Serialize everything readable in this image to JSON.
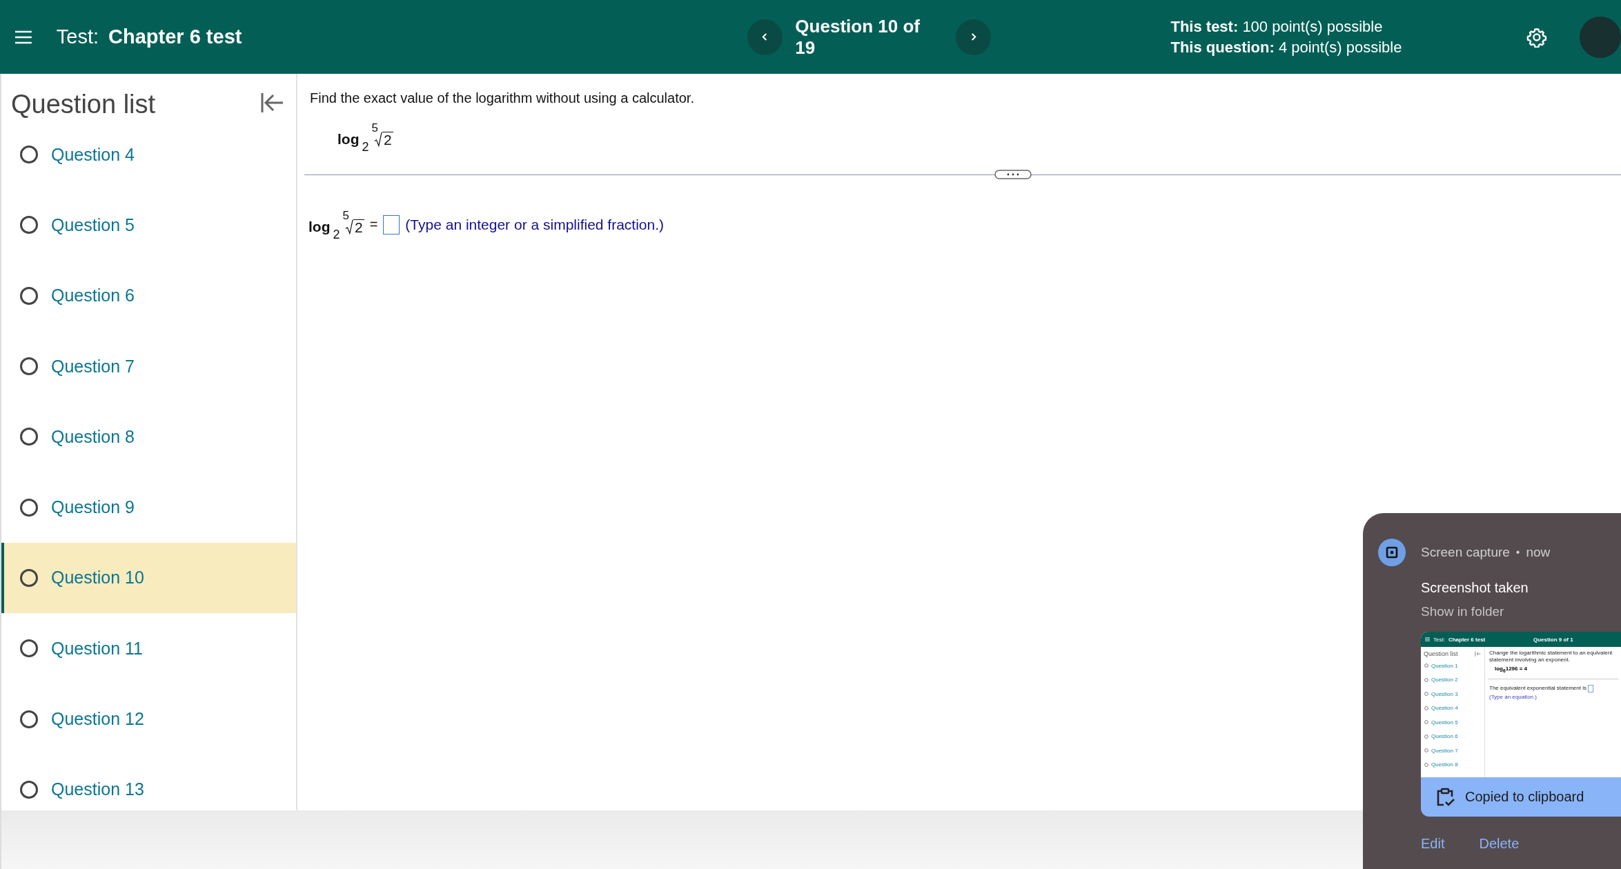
{
  "header": {
    "test_label": "Test:",
    "test_name": "Chapter 6 test",
    "question_position": "Question 10 of 19",
    "points": [
      {
        "label": "This test:",
        "value": "100 point(s) possible"
      },
      {
        "label": "This question:",
        "value": "4 point(s) possible"
      }
    ]
  },
  "sidebar": {
    "title": "Question list",
    "items": [
      {
        "label": "Question 4",
        "selected": false
      },
      {
        "label": "Question 5",
        "selected": false
      },
      {
        "label": "Question 6",
        "selected": false
      },
      {
        "label": "Question 7",
        "selected": false
      },
      {
        "label": "Question 8",
        "selected": false
      },
      {
        "label": "Question 9",
        "selected": false
      },
      {
        "label": "Question 10",
        "selected": true
      },
      {
        "label": "Question 11",
        "selected": false
      },
      {
        "label": "Question 12",
        "selected": false
      },
      {
        "label": "Question 13",
        "selected": false
      }
    ]
  },
  "question": {
    "prompt": "Find the exact value of the logarithm without using a calculator.",
    "expression": {
      "fn": "log",
      "base": "2",
      "index": "5",
      "radicand": "2"
    },
    "answer": {
      "expression": {
        "fn": "log",
        "base": "2",
        "index": "5",
        "radicand": "2"
      },
      "equals": "=",
      "hint": "(Type an integer or a simplified fraction.)"
    }
  },
  "notification": {
    "source": "Screen capture",
    "separator": "•",
    "time": "now",
    "title": "Screenshot taken",
    "link": "Show in folder",
    "thumbnail": {
      "test_label": "Test:",
      "test_name": "Chapter 6 test",
      "question_position": "Question 9 of 1",
      "sidebar_title": "Question list",
      "items": [
        "Question 1",
        "Question 2",
        "Question 3",
        "Question 4",
        "Question 5",
        "Question 6",
        "Question 7",
        "Question 8"
      ],
      "prompt": "Change the logarithmic statement to an equivalent statement involving an exponent.",
      "equation": "log$_{6}$1296 = 4",
      "answer_label": "The equivalent exponential statement is",
      "hint": "(Type an equation.)"
    },
    "banner": "Copied to clipboard",
    "actions": [
      "Edit",
      "Delete"
    ]
  }
}
